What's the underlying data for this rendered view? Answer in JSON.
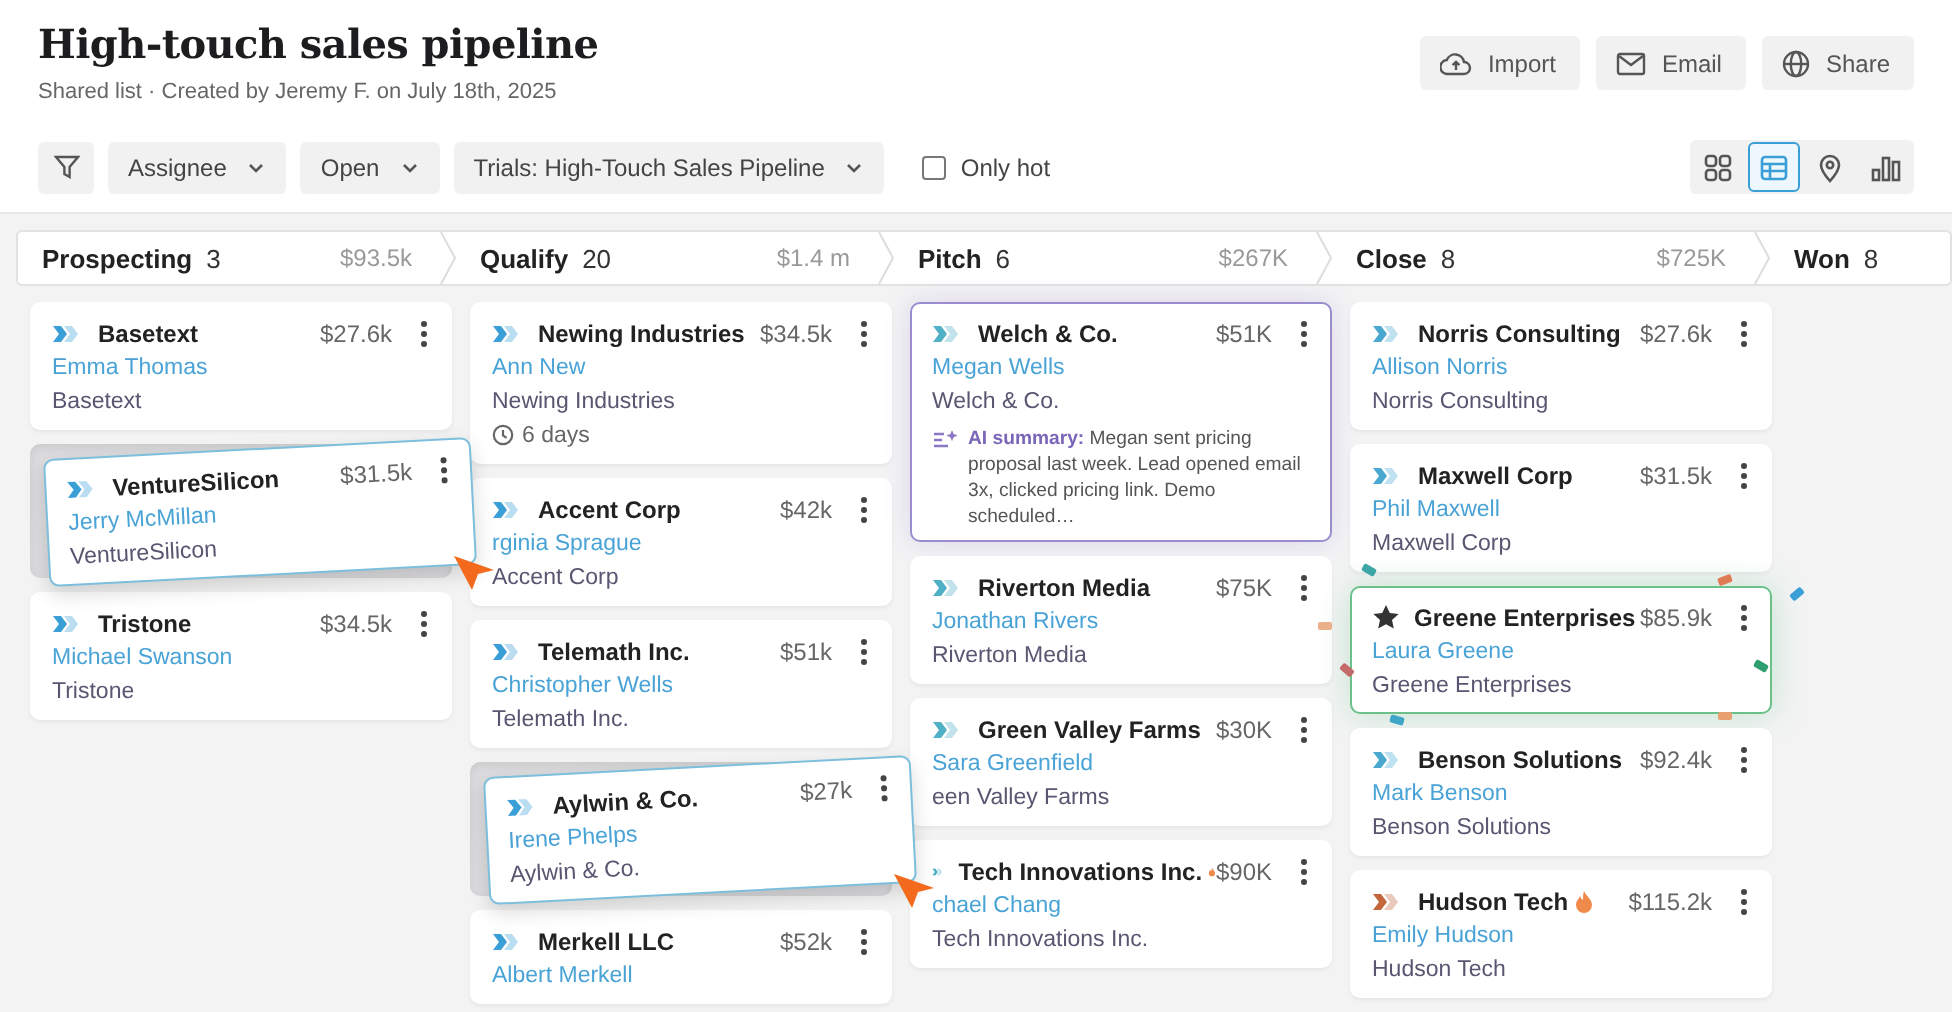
{
  "header": {
    "title": "High-touch sales pipeline",
    "subtitle": "Shared list · Created by Jeremy F. on July 18th, 2025",
    "actions": [
      {
        "kind": "import",
        "label": "Import"
      },
      {
        "kind": "email",
        "label": "Email"
      },
      {
        "kind": "share",
        "label": "Share"
      }
    ]
  },
  "toolbar": {
    "filters": [
      "Assignee",
      "Open",
      "Trials: High-Touch Sales Pipeline"
    ],
    "only_hot": {
      "label": "Only hot",
      "checked": false
    },
    "views": [
      {
        "kind": "grid",
        "selected": false
      },
      {
        "kind": "table",
        "selected": true
      },
      {
        "kind": "map",
        "selected": false
      },
      {
        "kind": "chart",
        "selected": false
      }
    ]
  },
  "stages": [
    {
      "name": "Prospecting",
      "count": "3",
      "total": "$93.5k",
      "cards": [
        {
          "kind": "tag",
          "color": "#3a9fd6",
          "name": "Basetext",
          "amount": "$27.6k",
          "contact": "Emma Thomas",
          "company": "Basetext"
        },
        {
          "kind": "tag",
          "color": "#3a9fd6",
          "name": "VentureSilicon",
          "amount": "$31.5k",
          "contact": "Jerry McMillan",
          "company": "VentureSilicon",
          "dragging": true
        },
        {
          "kind": "tag",
          "color": "#3a9fd6",
          "name": "Tristone",
          "amount": "$34.5k",
          "contact": "Michael Swanson",
          "company": "Tristone"
        }
      ]
    },
    {
      "name": "Qualify",
      "count": "20",
      "total": "$1.4 m",
      "cards": [
        {
          "kind": "tag",
          "color": "#3a9fd6",
          "name": "Newing Industries",
          "amount": "$34.5k",
          "contact": "Ann New",
          "company": "Newing Industries",
          "age": "6 days"
        },
        {
          "kind": "tag",
          "color": "#3a9fd6",
          "name": "Accent Corp",
          "amount": "$42k",
          "contact": "rginia Sprague",
          "company": "Accent Corp"
        },
        {
          "kind": "tag",
          "color": "#3a9fd6",
          "name": "Telemath Inc.",
          "amount": "$51k",
          "contact": "Christopher Wells",
          "company": "Telemath Inc."
        },
        {
          "kind": "tag",
          "color": "#3a9fd6",
          "name": "Aylwin & Co.",
          "amount": "$27k",
          "contact": "Irene Phelps",
          "company": "Aylwin & Co.",
          "dragging": true
        },
        {
          "kind": "tag",
          "color": "#3a9fd6",
          "name": "Merkell LLC",
          "amount": "$52k",
          "contact": "Albert Merkell"
        }
      ]
    },
    {
      "name": "Pitch",
      "count": "6",
      "total": "$267K",
      "cards": [
        {
          "kind": "tag",
          "color": "#4fb0c6",
          "name": "Welch & Co.",
          "amount": "$51K",
          "contact": "Megan Wells",
          "company": "Welch & Co.",
          "selected": true,
          "summary": "**AI summary:** Megan sent pricing proposal last week. Lead opened email 3x, clicked pricing link. Demo scheduled…"
        },
        {
          "kind": "tag",
          "color": "#4fb0c6",
          "name": "Riverton Media",
          "amount": "$75K",
          "contact": "Jonathan Rivers",
          "company": "Riverton Media"
        },
        {
          "kind": "tag",
          "color": "#4fb0c6",
          "name": "Green Valley Farms",
          "amount": "$30K",
          "contact": "Sara Greenfield",
          "company": "een Valley Farms"
        },
        {
          "kind": "tag",
          "color": "#4fb0c6",
          "name": "Tech Innovations Inc.",
          "amount": "$90K",
          "contact": "chael Chang",
          "company": "Tech Innovations Inc.",
          "hot": true
        }
      ]
    },
    {
      "name": "Close",
      "count": "8",
      "total": "$725K",
      "cards": [
        {
          "kind": "tag",
          "color": "#4aa8d0",
          "name": "Norris Consulting",
          "amount": "$27.6k",
          "contact": "Allison Norris",
          "company": "Norris Consulting"
        },
        {
          "kind": "tag",
          "color": "#4aa8d0",
          "name": "Maxwell Corp",
          "amount": "$31.5k",
          "contact": "Phil Maxwell",
          "company": "Maxwell Corp"
        },
        {
          "kind": "star",
          "color": "#333333",
          "name": "Greene Enterprises",
          "amount": "$85.9k",
          "contact": "Laura Greene",
          "company": "Greene Enterprises",
          "celebrated": true
        },
        {
          "kind": "tag",
          "color": "#4aa8d0",
          "name": "Benson Solutions",
          "amount": "$92.4k",
          "contact": "Mark Benson",
          "company": "Benson Solutions"
        },
        {
          "kind": "tag",
          "color": "#c4663c",
          "name": "Hudson Tech",
          "amount": "$115.2k",
          "contact": "Emily Hudson",
          "company": "Hudson Tech",
          "hot": true
        }
      ]
    },
    {
      "name": "Won",
      "count": "8"
    }
  ]
}
